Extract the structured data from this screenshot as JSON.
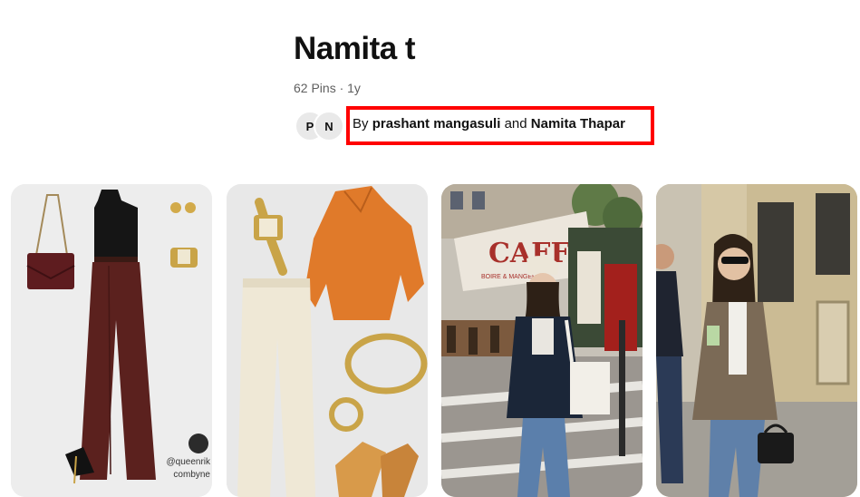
{
  "board": {
    "title": "Namita t",
    "meta": "62 Pins · 1y"
  },
  "collaborators": {
    "avatars": [
      "P",
      "N"
    ],
    "by_prefix": "By",
    "owner": "prashant mangasuli",
    "joiner": "and",
    "collaborator": "Namita Thapar"
  },
  "pins": [
    {
      "id": "pin-outfit-burgundy",
      "description": "burgundy outfit collage",
      "credits": [
        "@queenrik",
        "combyne"
      ]
    },
    {
      "id": "pin-outfit-orange",
      "description": "orange blouse outfit collage"
    },
    {
      "id": "pin-street-cafe",
      "description": "street style photo in front of cafe",
      "sign_text": "CAFF",
      "awning_text": "BOIRE & MANGER"
    },
    {
      "id": "pin-street-blazer",
      "description": "street style photo woman in brown blazer"
    }
  ],
  "colors": {
    "highlight": "#ff0000",
    "title": "#111111",
    "meta": "#5f5f5f"
  }
}
